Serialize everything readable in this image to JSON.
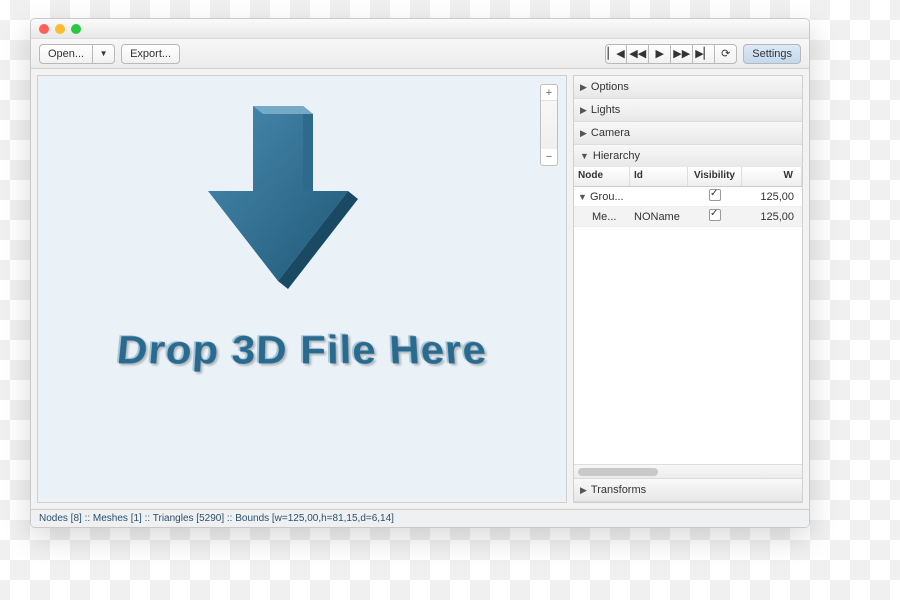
{
  "toolbar": {
    "open_label": "Open...",
    "export_label": "Export...",
    "settings_label": "Settings"
  },
  "viewport": {
    "drop_text": "Drop 3D File Here"
  },
  "panels": {
    "options": "Options",
    "lights": "Lights",
    "camera": "Camera",
    "hierarchy": "Hierarchy",
    "transforms": "Transforms"
  },
  "hierarchy": {
    "columns": {
      "node": "Node",
      "id": "Id",
      "visibility": "Visibility",
      "w": "W"
    },
    "rows": [
      {
        "node": "Grou...",
        "id": "",
        "visible": true,
        "w": "125,00",
        "indent": 0,
        "expanded": true
      },
      {
        "node": "Me...",
        "id": "NOName",
        "visible": true,
        "w": "125,00",
        "indent": 1,
        "expanded": false
      }
    ]
  },
  "status": "Nodes [8] :: Meshes [1] :: Triangles [5290] :: Bounds [w=125,00,h=81,15,d=6,14]"
}
